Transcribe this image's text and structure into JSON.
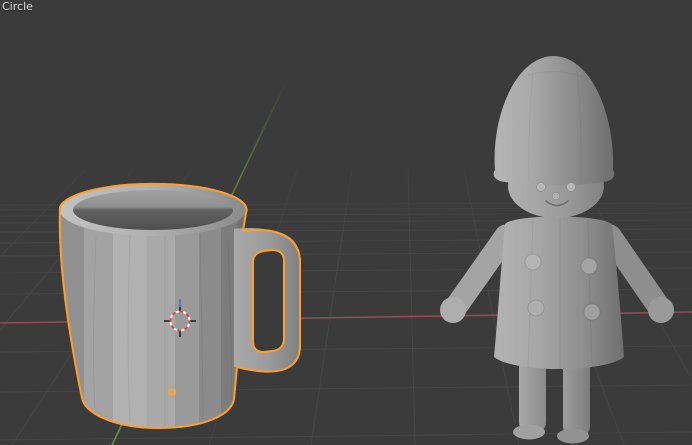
{
  "viewport": {
    "overlay_label": "Circle"
  },
  "colors": {
    "background": "#3b3b3b",
    "grid_line": "#474747",
    "axis_x": "#9d5257",
    "axis_y": "#6f9143",
    "axis_z": "#4a6fd6",
    "selection_outline": "#ff9e2d",
    "origin_dot": "#ffa433",
    "cursor_red": "#cf4545",
    "cursor_white": "#f0f0f0",
    "cursor_tick": "#1d1d1d"
  }
}
